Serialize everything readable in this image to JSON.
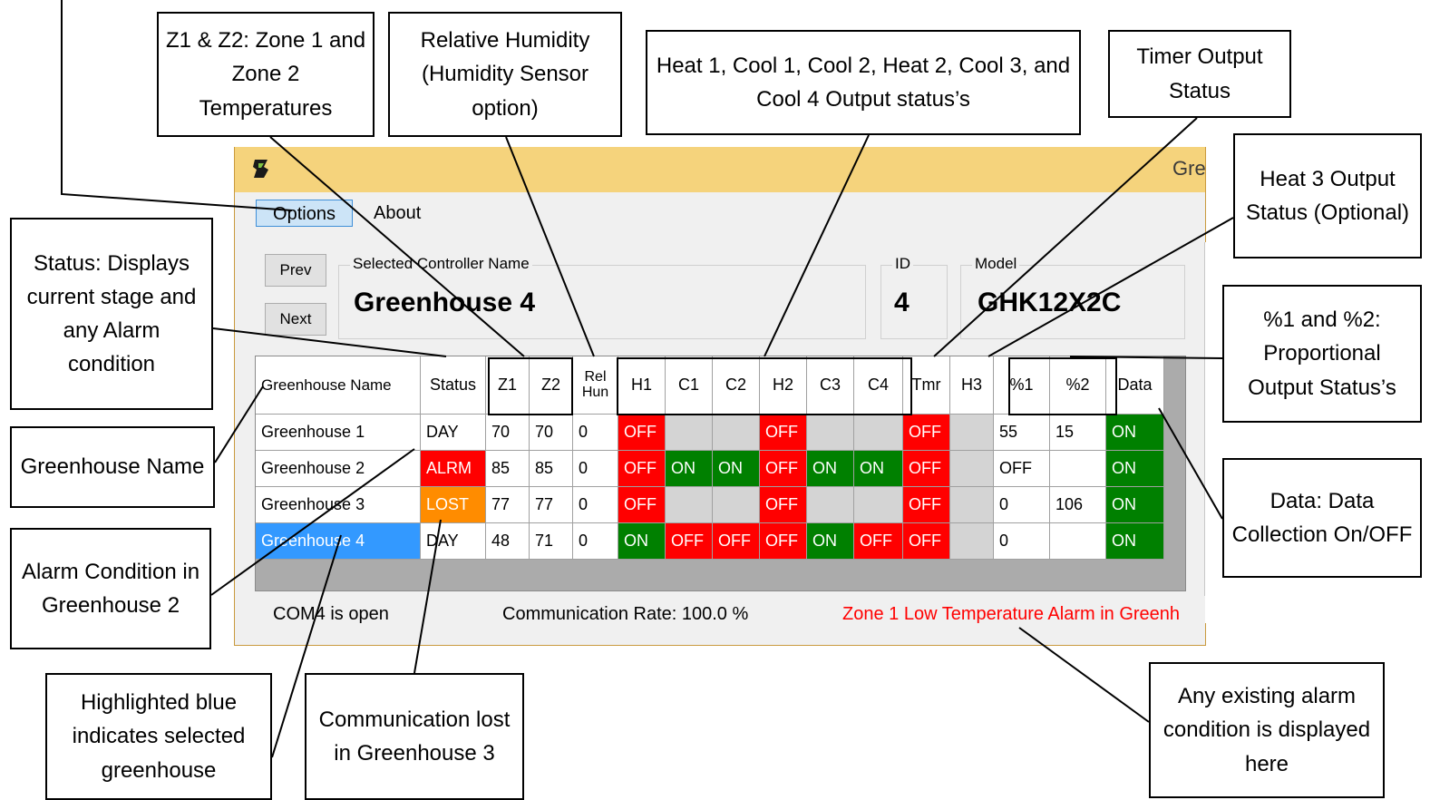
{
  "window": {
    "title": "Gre"
  },
  "menu": {
    "options": "Options",
    "about": "About"
  },
  "nav": {
    "prev": "Prev",
    "next": "Next"
  },
  "controller": {
    "name_label": "Selected Controller Name",
    "name": "Greenhouse 4",
    "id_label": "ID",
    "id": "4",
    "model_label": "Model",
    "model": "GHK12X2C"
  },
  "table": {
    "columns": [
      {
        "label": "Greenhouse Name"
      },
      {
        "label": "Status"
      },
      {
        "label": "Z1"
      },
      {
        "label": "Z2"
      },
      {
        "label": "Rel Hun"
      },
      {
        "label": "H1"
      },
      {
        "label": "C1"
      },
      {
        "label": "C2"
      },
      {
        "label": "H2"
      },
      {
        "label": "C3"
      },
      {
        "label": "C4"
      },
      {
        "label": "Tmr"
      },
      {
        "label": "H3"
      },
      {
        "label": "%1"
      },
      {
        "label": "%2"
      },
      {
        "label": "Data"
      }
    ],
    "rows": [
      {
        "name": "Greenhouse 1",
        "status": "DAY",
        "z1": "70",
        "z2": "70",
        "rh": "0",
        "h1": "OFF",
        "c1": "",
        "c2": "",
        "h2": "OFF",
        "c3": "",
        "c4": "",
        "tmr": "OFF",
        "h3": "",
        "p1": "55",
        "p2": "15",
        "data": "ON",
        "selected": false
      },
      {
        "name": "Greenhouse 2",
        "status": "ALRM",
        "z1": "85",
        "z2": "85",
        "rh": "0",
        "h1": "OFF",
        "c1": "ON",
        "c2": "ON",
        "h2": "OFF",
        "c3": "ON",
        "c4": "ON",
        "tmr": "OFF",
        "h3": "",
        "p1": "OFF",
        "p2": "",
        "data": "ON",
        "selected": false
      },
      {
        "name": "Greenhouse 3",
        "status": "LOST",
        "z1": "77",
        "z2": "77",
        "rh": "0",
        "h1": "OFF",
        "c1": "",
        "c2": "",
        "h2": "OFF",
        "c3": "",
        "c4": "",
        "tmr": "OFF",
        "h3": "",
        "p1": "0",
        "p2": "106",
        "data": "ON",
        "selected": false
      },
      {
        "name": "Greenhouse 4",
        "status": "DAY",
        "z1": "48",
        "z2": "71",
        "rh": "0",
        "h1": "ON",
        "c1": "OFF",
        "c2": "OFF",
        "h2": "OFF",
        "c3": "ON",
        "c4": "OFF",
        "tmr": "OFF",
        "h3": "",
        "p1": "0",
        "p2": "",
        "data": "ON",
        "selected": true
      }
    ]
  },
  "statusbar": {
    "port": "COM4 is open",
    "rate": "Communication Rate: 100.0 %",
    "alarm": "Zone 1 Low Temperature Alarm in Greenh"
  },
  "callouts": {
    "zones": "Z1 & Z2: Zone 1 and Zone 2 Temperatures",
    "humidity": "Relative Humidity (Humidity Sensor option)",
    "outputs": "Heat 1, Cool 1, Cool 2, Heat 2, Cool 3, and Cool 4 Output status’s",
    "timer": "Timer Output Status",
    "heat3": "Heat 3 Output Status (Optional)",
    "status": "Status: Displays current stage and any Alarm condition",
    "proportional": "%1 and %2: Proportional Output Status’s",
    "name": "Greenhouse Name",
    "data": "Data: Data Collection On/OFF",
    "alarm_gh2": "Alarm Condition in Greenhouse 2",
    "selected": "Highlighted blue indicates selected greenhouse",
    "lost": "Communication lost in Greenhouse 3",
    "alarm_display": "Any existing alarm condition is displayed here"
  },
  "colors": {
    "off": "#ff0000",
    "on": "#008000",
    "lost": "#ff8c00",
    "selected": "#3399ff",
    "empty": "#d4d4d4",
    "titlebar": "#f5d37c",
    "alarm_text": "#ff0000"
  }
}
